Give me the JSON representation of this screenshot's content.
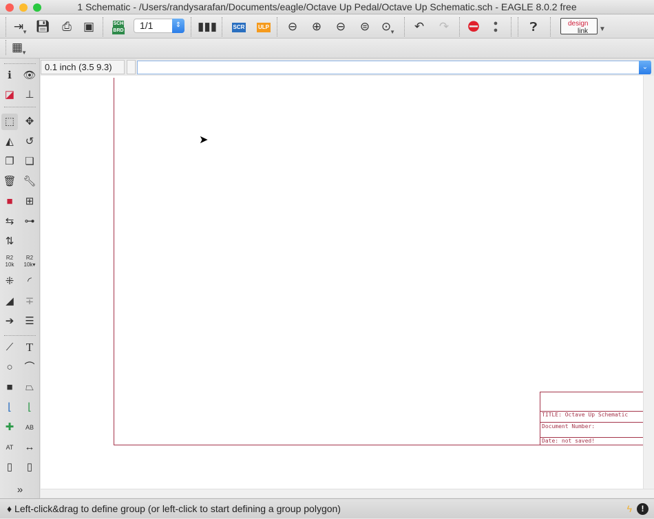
{
  "window": {
    "title": "1 Schematic - /Users/randysarafan/Documents/eagle/Octave Up Pedal/Octave Up Schematic.sch - EAGLE 8.0.2 free"
  },
  "toolbar": {
    "open_icon": "open-icon",
    "save_icon": "save-icon",
    "print_icon": "print-icon",
    "cam_icon": "cam-icon",
    "sch_label": "SCH",
    "brd_label": "BRD",
    "page_value": "1/1",
    "scr_label": "SCR",
    "ulp_label": "ULP",
    "design_label": "design",
    "link_label": "link"
  },
  "command": {
    "grid_info": "0.1 inch (3.5 9.3)",
    "input_value": "",
    "input_placeholder": ""
  },
  "title_block": {
    "title": "TITLE:  Octave Up Schematic",
    "document_number": "Document Number:",
    "date": "Date: not saved!"
  },
  "status": {
    "message": "Left-click&drag to define group (or left-click to start defining a group polygon)"
  },
  "colors": {
    "frame": "#a4344a",
    "accent": "#2a7de8",
    "stop": "#e0202c"
  }
}
